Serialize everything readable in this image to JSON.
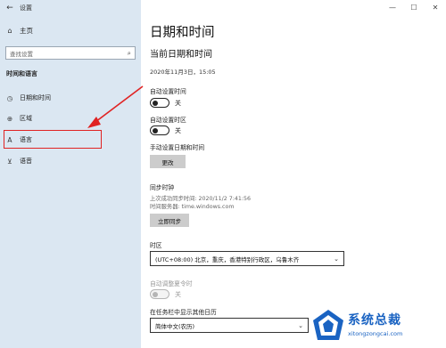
{
  "window": {
    "app_title": "设置",
    "back_glyph": "←",
    "controls": [
      "—",
      "☐",
      "✕"
    ]
  },
  "sidebar": {
    "home_label": "主页",
    "search_placeholder": "查找设置",
    "section_title": "时间和语言",
    "items": [
      {
        "label": "日期和时间",
        "icon": "calendar-clock-icon",
        "glyph": "◷"
      },
      {
        "label": "区域",
        "icon": "globe-icon",
        "glyph": "⊕"
      },
      {
        "label": "语言",
        "icon": "language-icon",
        "glyph": "A"
      },
      {
        "label": "语音",
        "icon": "microphone-icon",
        "glyph": "⊻"
      }
    ],
    "highlighted_item_index": 2
  },
  "main": {
    "page_title": "日期和时间",
    "section_heading": "当前日期和时间",
    "current_datetime": "2020年11月3日，15:05",
    "auto_time": {
      "label": "自动设置时间",
      "state_text": "关",
      "on": false
    },
    "auto_timezone": {
      "label": "自动设置时区",
      "state_text": "关",
      "on": false
    },
    "manual_set": {
      "label": "手动设置日期和时间",
      "button": "更改"
    },
    "sync": {
      "heading": "同步时钟",
      "last_sync": "上次成功同步时间: 2020/11/2 7:41:56",
      "server": "时间服务器: time.windows.com",
      "button": "立即同步"
    },
    "timezone": {
      "label": "时区",
      "value": "(UTC+08:00) 北京，重庆，香港特别行政区，乌鲁木齐"
    },
    "dst": {
      "label": "自动调整夏令时",
      "state_text": "关",
      "on": false,
      "disabled": true
    },
    "extra_calendar": {
      "label": "在任务栏中显示其他日历",
      "value": "简体中文(农历)"
    }
  },
  "annotation": {
    "color": "#e02323"
  },
  "watermark": {
    "text_cn": "系统总裁",
    "text_en": "xitongzongcai.com"
  },
  "colors": {
    "sidebar_bg": "#dbe7f2",
    "button_bg": "#cccccc",
    "accent_blue": "#1a63c2"
  }
}
